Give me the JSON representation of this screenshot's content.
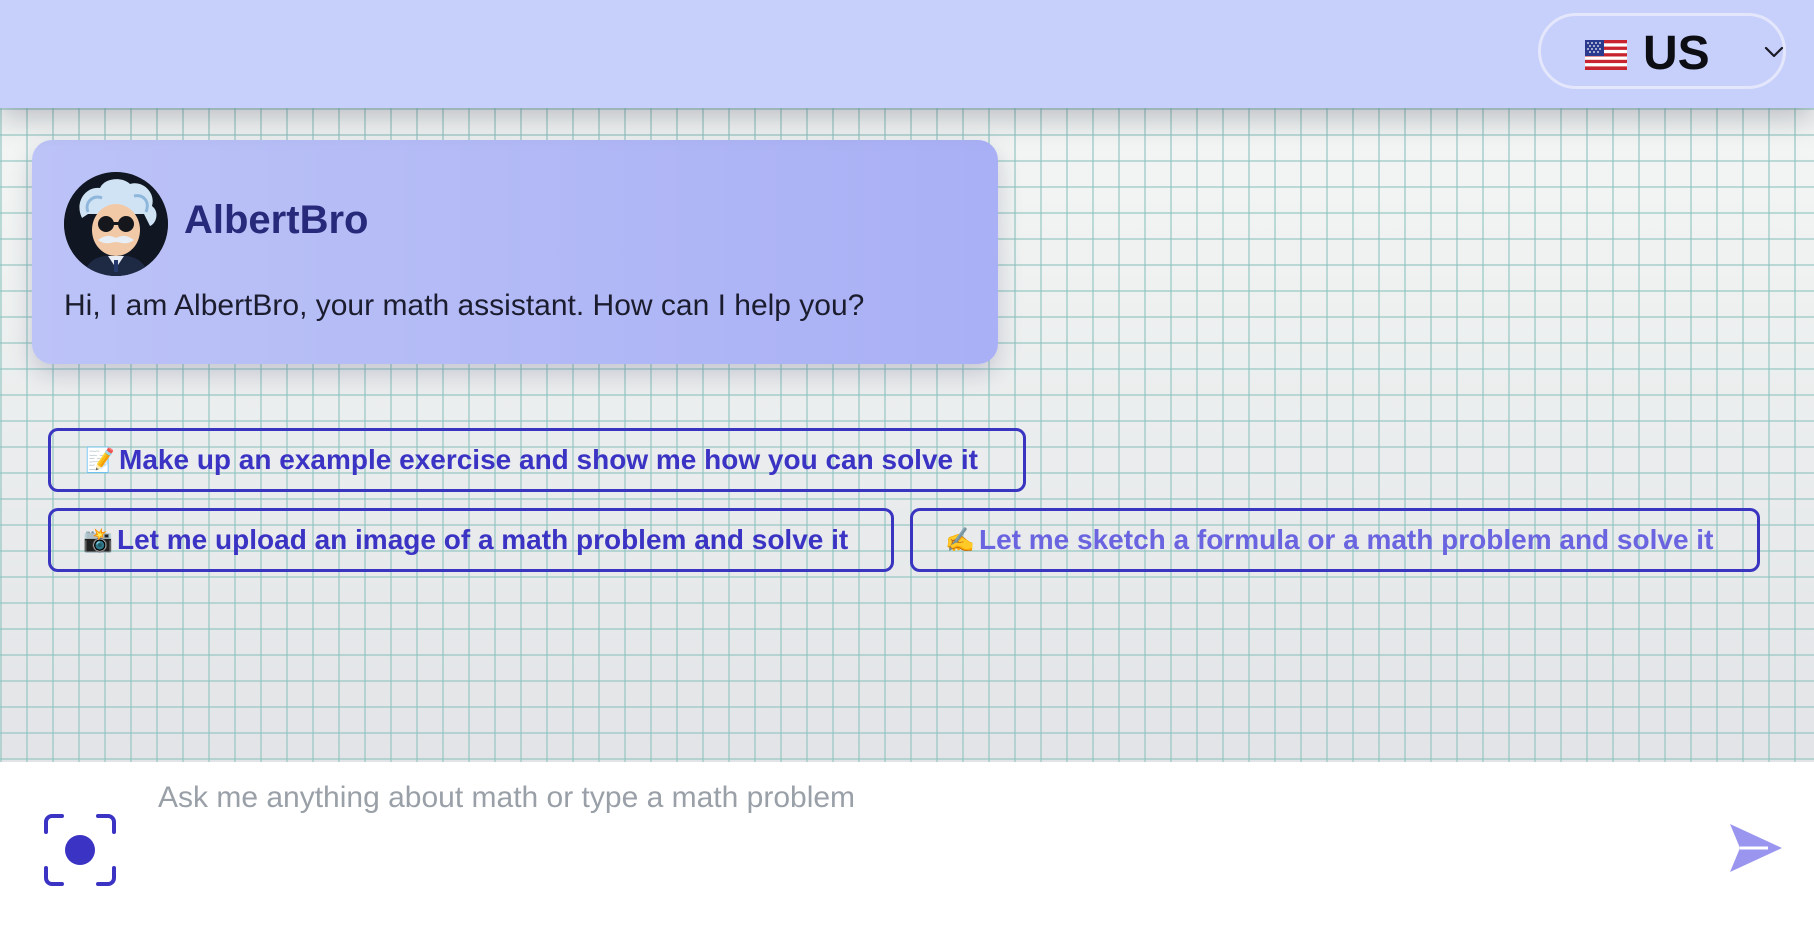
{
  "header": {
    "language": {
      "flag_icon": "us-flag-icon",
      "label": "US",
      "chevron_icon": "chevron-down-icon"
    }
  },
  "chat": {
    "bot": {
      "avatar_icon": "einstein-avatar-icon",
      "name": "AlbertBro",
      "greeting": "Hi, I am AlbertBro, your math assistant. How can I help you?"
    },
    "suggestions": [
      {
        "emoji": "📝",
        "label": "Make up an example exercise and show me how you can solve it"
      },
      {
        "emoji": "📸",
        "label": "Let me upload an image of a math problem and solve it"
      },
      {
        "emoji": "✍️",
        "label": "Let me sketch a formula or a math problem and solve it"
      }
    ]
  },
  "input": {
    "placeholder": "Ask me anything about math or type a math problem",
    "value": "",
    "camera_icon": "camera-scan-icon",
    "send_icon": "send-icon"
  },
  "colors": {
    "header_bg": "#c7cffb",
    "accent": "#3b33c4",
    "accent_light": "#6a64e0",
    "card_bg": "#aeb5f6",
    "send_icon": "#9a95ee"
  }
}
